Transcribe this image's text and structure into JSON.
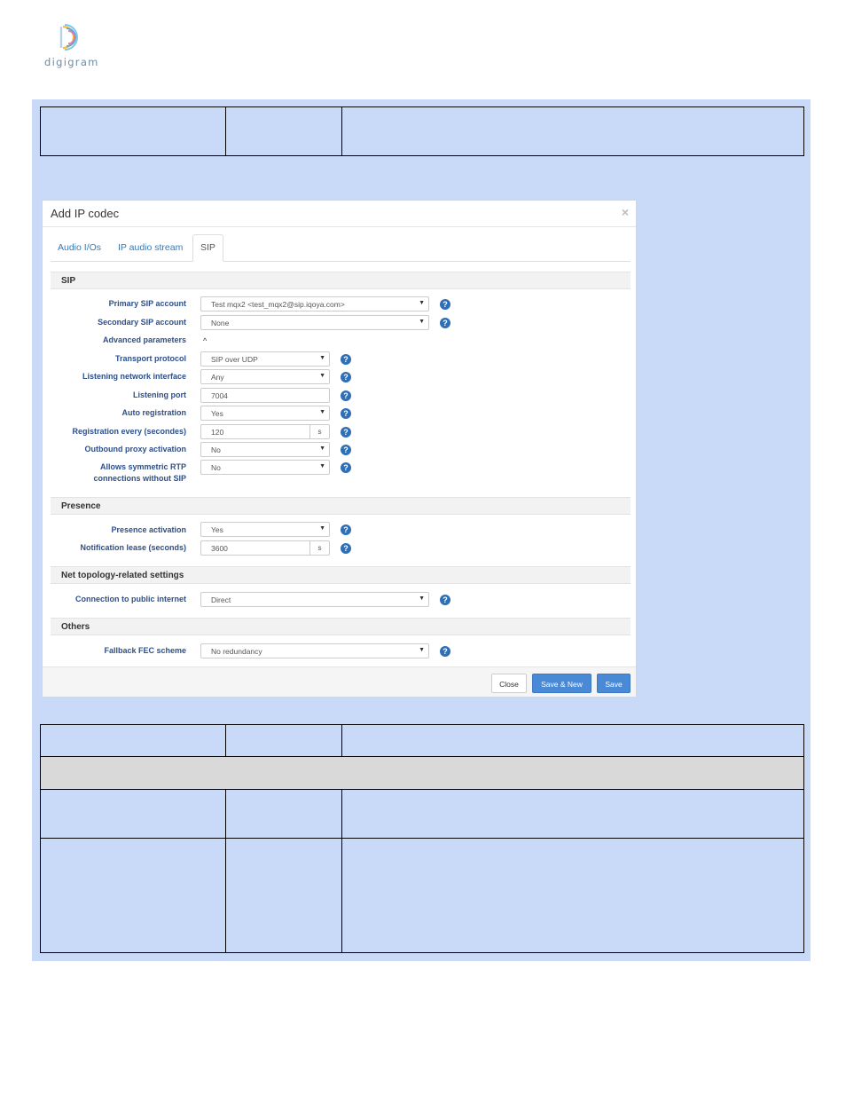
{
  "logo": {
    "text": "digigram"
  },
  "modal": {
    "title": "Add IP codec",
    "close_symbol": "×",
    "tabs": [
      {
        "label": "Audio I/Os"
      },
      {
        "label": "IP audio stream"
      },
      {
        "label": "SIP",
        "active": true
      }
    ],
    "sections": {
      "sip": "SIP",
      "presence": "Presence",
      "net": "Net topology-related settings",
      "others": "Others"
    },
    "fields": {
      "primary_sip": {
        "label": "Primary SIP account",
        "value": "Test mqx2 <test_mqx2@sip.iqoya.com>"
      },
      "secondary_sip": {
        "label": "Secondary SIP account",
        "value": "None"
      },
      "advanced": {
        "label": "Advanced parameters",
        "chevron": "^"
      },
      "transport": {
        "label": "Transport protocol",
        "value": "SIP over UDP"
      },
      "listen_iface": {
        "label": "Listening network interface",
        "value": "Any"
      },
      "listen_port": {
        "label": "Listening port",
        "value": "7004"
      },
      "auto_reg": {
        "label": "Auto registration",
        "value": "Yes"
      },
      "reg_every": {
        "label": "Registration every (secondes)",
        "value": "120",
        "unit": "s"
      },
      "outbound_proxy": {
        "label": "Outbound proxy activation",
        "value": "No"
      },
      "symmetric_rtp": {
        "label_line1": "Allows symmetric RTP",
        "label_line2": "connections without SIP",
        "value": "No"
      },
      "presence_act": {
        "label": "Presence activation",
        "value": "Yes"
      },
      "notif_lease": {
        "label": "Notification lease (seconds)",
        "value": "3600",
        "unit": "s"
      },
      "public_internet": {
        "label": "Connection to public internet",
        "value": "Direct"
      },
      "fallback_fec": {
        "label": "Fallback FEC scheme",
        "value": "No redundancy"
      }
    },
    "buttons": {
      "close": "Close",
      "save_new": "Save & New",
      "save": "Save"
    },
    "help_symbol": "?",
    "caret_symbol": "▼"
  },
  "colors": {
    "panel_bg": "#c9daf8",
    "primary_button": "#4a89d6",
    "help_icon": "#2f6fb5",
    "gray_row": "#d9d9d9"
  }
}
